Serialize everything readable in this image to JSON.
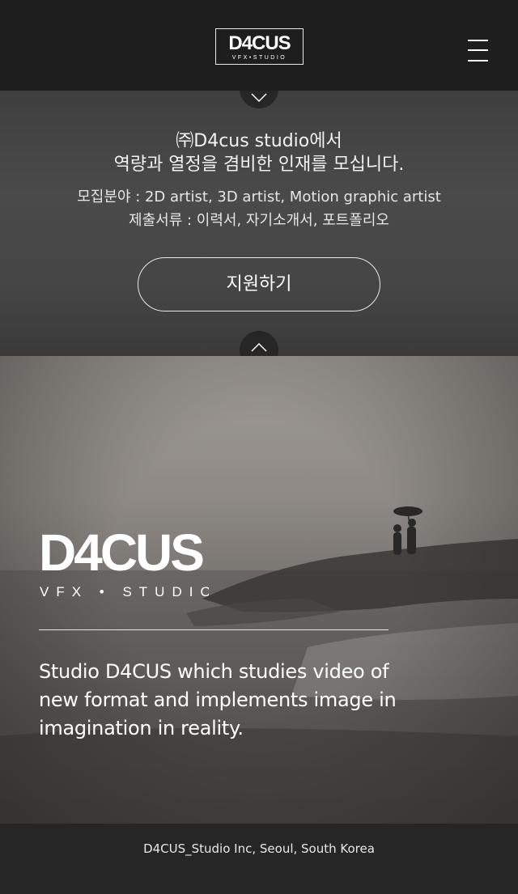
{
  "header": {
    "logo_main": "D4CUS",
    "logo_sub": "VFX•STUDIO",
    "menu_icon": "hamburger-menu-icon"
  },
  "recruit": {
    "title_line1": "㈜D4cus studio에서",
    "title_line2": "역량과 열정을 겸비한 인재를 모십니다.",
    "field_line": "모집분야 : 2D artist, 3D artist, Motion graphic artist",
    "docs_line": "제출서류 : 이력서, 자기소개서, 포트폴리오",
    "apply_label": "지원하기",
    "scroll_down_icon": "chevron-down-icon",
    "scroll_up_icon": "chevron-up-icon"
  },
  "hero": {
    "brand_main": "D4CUS",
    "brand_sub": "VFX • STUDIO",
    "tagline_line1": "Studio D4CUS which studies video of",
    "tagline_line2": "new format and implements image in",
    "tagline_line3": "imagination in reality."
  },
  "footer": {
    "text": "D4CUS_Studio Inc, Seoul, South Korea"
  }
}
